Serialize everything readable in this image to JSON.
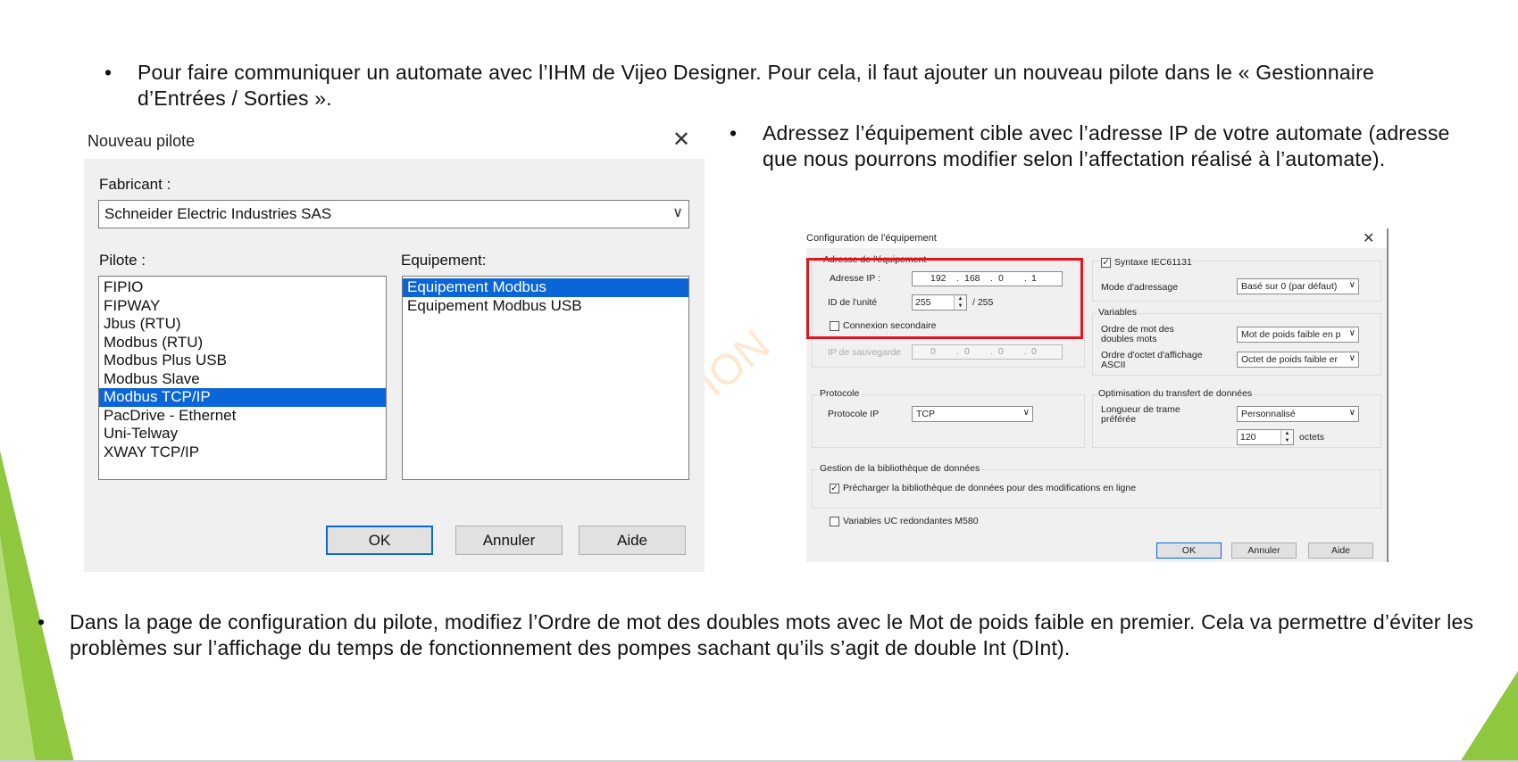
{
  "slide": {
    "bullet_top": "Pour faire communiquer un automate avec l’IHM de Vijeo Designer. Pour cela, il faut ajouter un nouveau pilote dans le « Gestionnaire d’Entrées / Sorties ».",
    "bullet_right": "Adressez l’équipement cible avec l’adresse IP de votre automate (adresse que nous pourrons modifier selon l’affectation réalisé à l’automate).",
    "bullet_bottom": "Dans la page de configuration du pilote, modifiez l’Ordre de mot des doubles mots avec le Mot de poids faible en premier. Cela va permettre d’éviter les problèmes sur l’affichage du temps de fonctionnement des pompes sachant qu’ils s’agit de double Int (DInt).",
    "bullet_glyph": "•",
    "accent_green": "#8fc73e",
    "watermark": "ION"
  },
  "dialog_new_driver": {
    "title": "Nouveau pilote",
    "close_glyph": "✕",
    "manufacturer_label": "Fabricant :",
    "manufacturer_value": "Schneider Electric Industries SAS",
    "driver_label": "Pilote :",
    "drivers": [
      "FIPIO",
      "FIPWAY",
      "Jbus (RTU)",
      "Modbus (RTU)",
      "Modbus Plus USB",
      "Modbus Slave",
      "Modbus TCP/IP",
      "PacDrive - Ethernet",
      "Uni-Telway",
      "XWAY TCP/IP"
    ],
    "selected_driver": "Modbus TCP/IP",
    "equipment_label": "Equipement:",
    "equipment": [
      "Equipement Modbus",
      "Equipement Modbus USB"
    ],
    "selected_equipment": "Equipement Modbus",
    "ok": "OK",
    "cancel": "Annuler",
    "help": "Aide"
  },
  "dialog_config": {
    "title": "Configuration de l'équipement",
    "close_glyph": "✕",
    "address_group": "Adresse de l'équipement",
    "ip_label": "Adresse IP :",
    "ip": [
      "192",
      "168",
      "0",
      "1"
    ],
    "unit_id_label": "ID de l'unité",
    "unit_id": "255",
    "unit_id_max": "/ 255",
    "secondary_label": "Connexion secondaire",
    "backup_ip_label": "IP de sauvegarde",
    "backup_ip": [
      "0",
      "0",
      "0",
      "0"
    ],
    "protocol_group": "Protocole",
    "protocol_ip_label": "Protocole IP",
    "protocol_value": "TCP",
    "iec_label": "Syntaxe IEC61131",
    "addressing_label": "Mode d'adressage",
    "addressing_value": "Basé sur 0 (par défaut)",
    "variables_group": "Variables",
    "word_order_label_1": "Ordre de mot des",
    "word_order_label_2": "doubles mots",
    "word_order_value": "Mot de poids faible en p",
    "byte_order_label_1": "Ordre d'octet d'affichage",
    "byte_order_label_2": "ASCII",
    "byte_order_value": "Octet de poids faible er",
    "transfer_group": "Optimisation du transfert de données",
    "frame_label_1": "Longueur de trame",
    "frame_label_2": "préférée",
    "frame_value": "Personnalisé",
    "bytes_value": "120",
    "bytes_unit": "octets",
    "library_group": "Gestion de la bibliothèque de données",
    "preload_label": "Précharger la bibliothèque de données pour des modifications en ligne",
    "redundant_label": "Variables UC redondantes M580",
    "ok": "OK",
    "cancel": "Annuler",
    "help": "Aide",
    "highlight_color": "#e0161e"
  }
}
